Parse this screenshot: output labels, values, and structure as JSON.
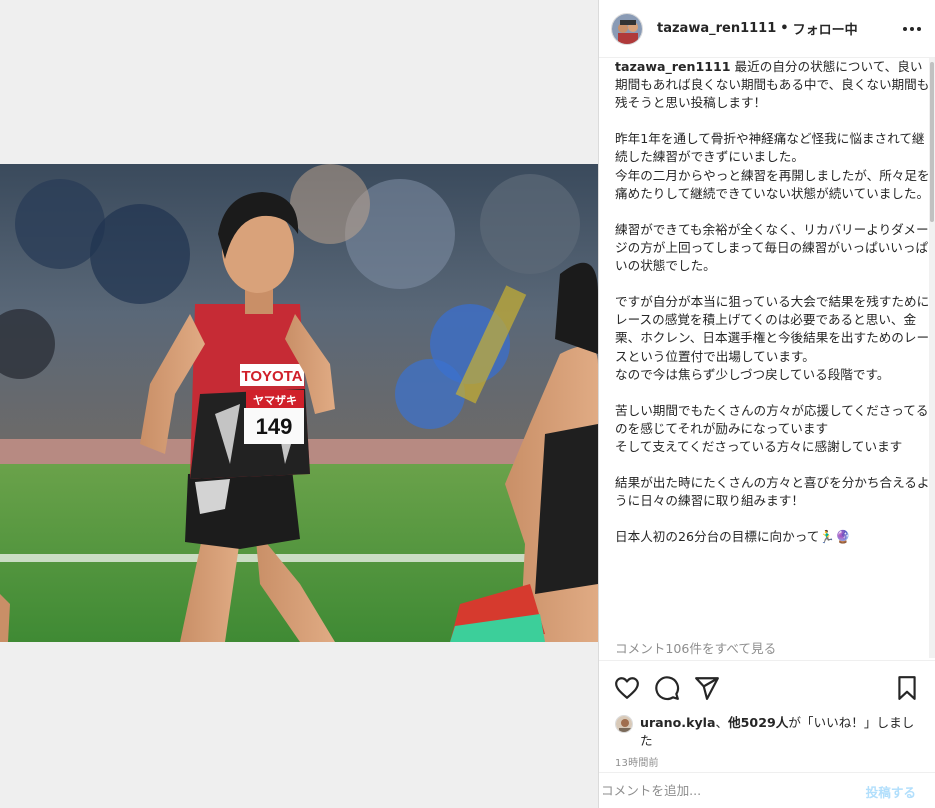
{
  "post": {
    "author": "tazawa_ren1111",
    "separator": "•",
    "follow_status": "フォロー中",
    "more_icon": "more-horizontal-icon"
  },
  "caption": {
    "username": "tazawa_ren1111",
    "text": " 最近の自分の状態について、良い期間もあれば良くない期間もある中で、良くない期間も残そうと思い投稿します！\n\n昨年1年を通して骨折や神経痛など怪我に悩まされて継続した練習ができずにいました。\n今年の二月からやっと練習を再開しましたが、所々足を痛めたりして継続できていない状態が続いていました。\n\n練習ができても余裕が全くなく、リカバリーよりダメージの方が上回ってしまって毎日の練習がいっぱいいっぱいの状態でした。\n\nですが自分が本当に狙っている大会で結果を残すためにレースの感覚を積上げてくのは必要であると思い、金栗、ホクレン、日本選手権と今後結果を出すためのレースという位置付で出場しています。\nなので今は焦らず少しづつ戻している段階です。\n\n苦しい期間でもたくさんの方々が応援してくださってるのを感じてそれが励みになっています\nそして支えてくださっている方々に感謝しています\n\n結果が出た時にたくさんの方々と喜びを分かち合えるように日々の練習に取り組みます！\n\n日本人初の26分台の目標に向かって🏃‍♂️🔮",
    "view_comments": "コメント106件をすべて見る"
  },
  "photo": {
    "bib_number": "149",
    "sponsor": "TOYOTA",
    "sponsor2": "ヤマザキ"
  },
  "actions": {
    "like_icon": "heart-icon",
    "comment_icon": "comment-icon",
    "share_icon": "send-icon",
    "save_icon": "bookmark-icon"
  },
  "likes": {
    "first_user": "urano.kyla",
    "middle": "、",
    "others": "他5029人",
    "suffix": "が「いいね！」しました"
  },
  "timestamp": "13時間前",
  "comment_box": {
    "placeholder": "コメントを追加...",
    "post_label": "投稿する"
  }
}
